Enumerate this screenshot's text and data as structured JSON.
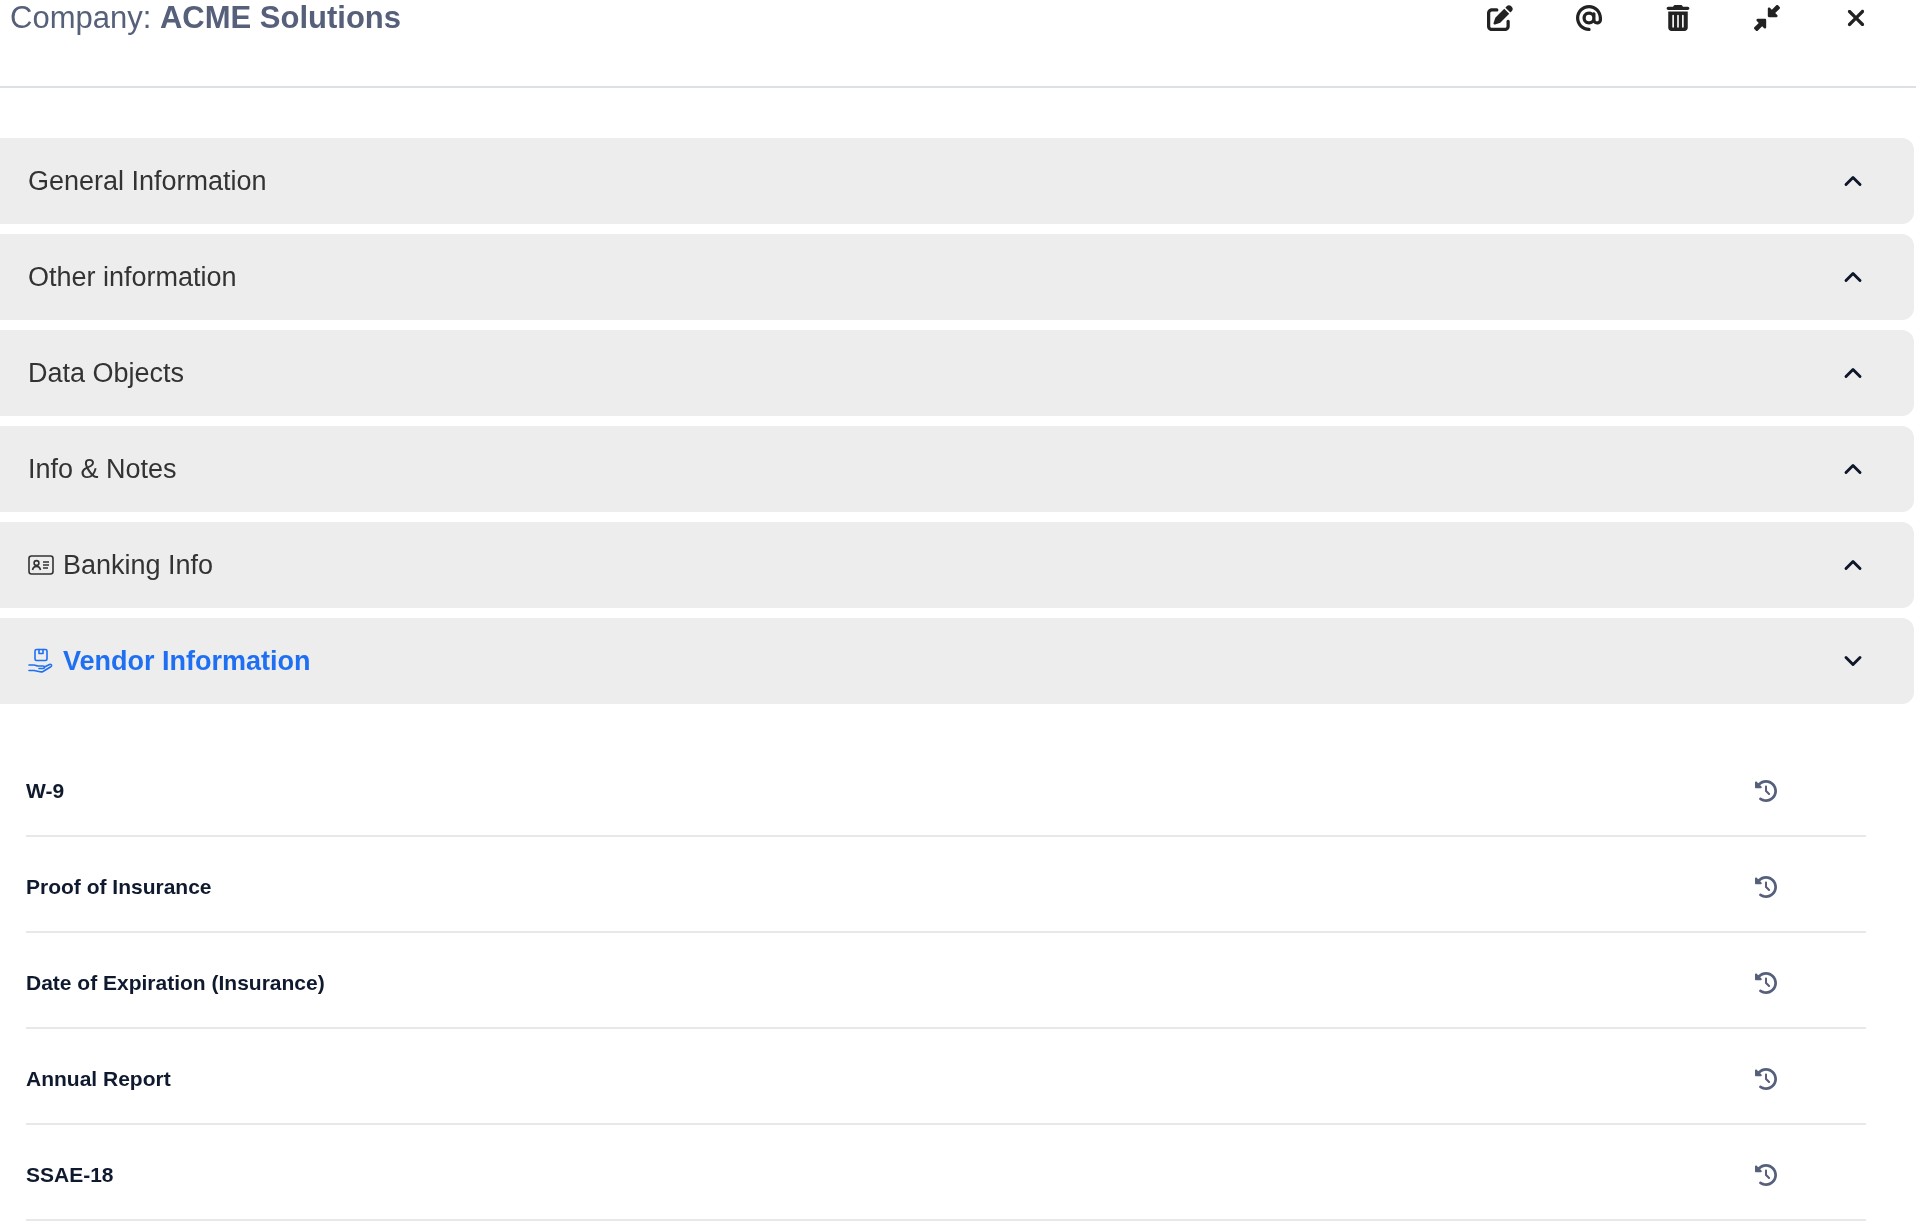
{
  "header": {
    "title": "Company: **ACME Solutions**"
  },
  "sections": [
    {
      "title": "General Information",
      "kind": "plain",
      "expanded": false
    },
    {
      "title": "Other information",
      "kind": "plain",
      "expanded": false
    },
    {
      "title": "Data Objects",
      "kind": "plain",
      "expanded": false
    },
    {
      "title": "Info & Notes",
      "kind": "plain",
      "expanded": false
    },
    {
      "title": "Banking Info",
      "kind": "card",
      "expanded": false
    },
    {
      "title": "Vendor Information",
      "kind": "vendor",
      "expanded": true,
      "rows": [
        {
          "label": "W-9"
        },
        {
          "label": "Proof of Insurance"
        },
        {
          "label": "Date of Expiration (Insurance)"
        },
        {
          "label": "Annual Report"
        },
        {
          "label": "SSAE-18"
        }
      ]
    }
  ]
}
